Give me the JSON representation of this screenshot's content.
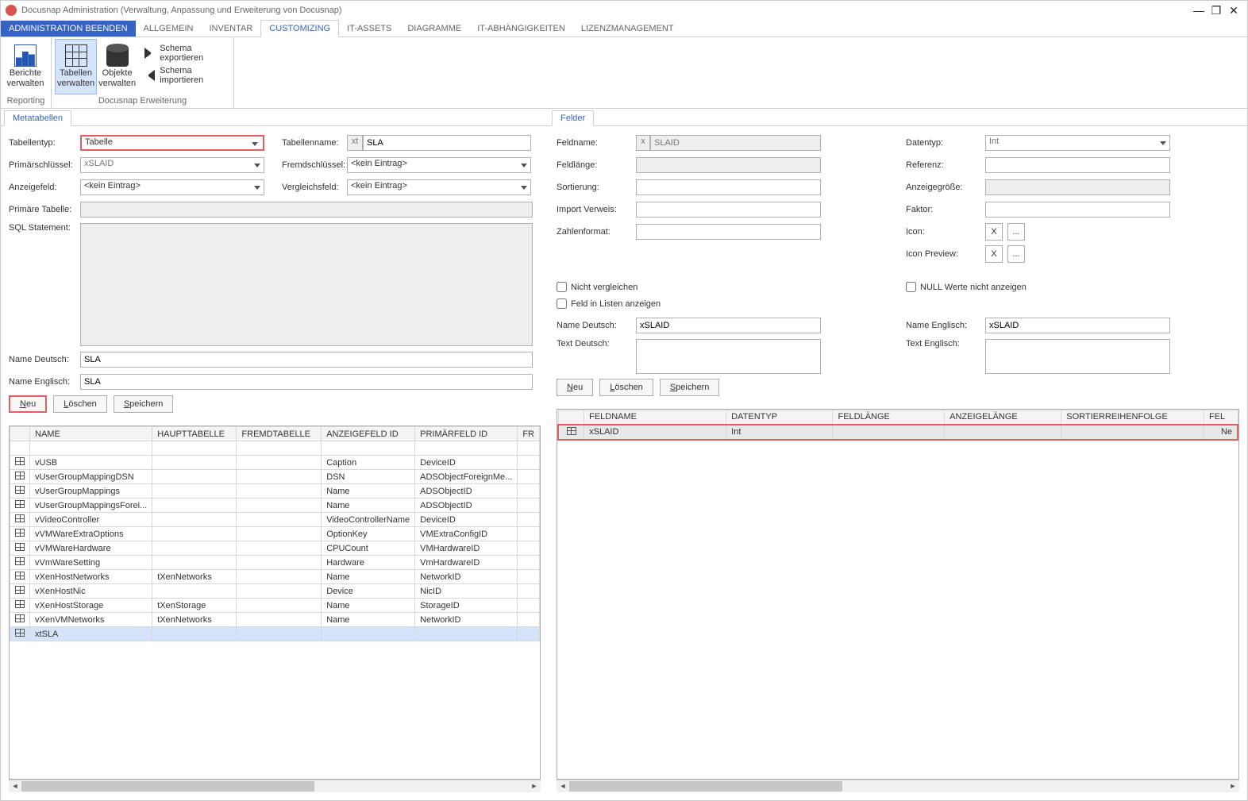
{
  "window": {
    "title": "Docusnap Administration (Verwaltung, Anpassung und Erweiterung von Docusnap)"
  },
  "winbuttons": {
    "min": "—",
    "max": "❐",
    "close": "✕"
  },
  "maintabs": {
    "file": "Administration beenden",
    "items": [
      "ALLGEMEIN",
      "INVENTAR",
      "CUSTOMIZING",
      "IT-ASSETS",
      "DIAGRAMME",
      "IT-ABHÄNGIGKEITEN",
      "LIZENZMANAGEMENT"
    ],
    "activeIndex": 2
  },
  "ribbon": {
    "group_reporting": {
      "label": "Reporting",
      "btn_reports": "Berichte verwalten"
    },
    "group_ext": {
      "label": "Docusnap Erweiterung",
      "btn_tables": "Tabellen verwalten",
      "btn_objects": "Objekte verwalten",
      "btn_export": "Schema exportieren",
      "btn_import": "Schema importieren"
    }
  },
  "left": {
    "tab": "Metatabellen",
    "labels": {
      "tabellentyp": "Tabellentyp:",
      "primaer": "Primärschlüssel:",
      "anzeigefeld": "Anzeigefeld:",
      "primTab": "Primäre Tabelle:",
      "sql": "SQL Statement:",
      "nameDE": "Name Deutsch:",
      "nameEN": "Name Englisch:",
      "tabellenname": "Tabellenname:",
      "fremd": "Fremdschlüssel:",
      "vergleich": "Vergleichsfeld:"
    },
    "values": {
      "tabellentyp": "Tabelle",
      "primaer": "xSLAID",
      "anzeigefeld": "<kein Eintrag>",
      "primTab": "",
      "sql": "",
      "nameDE": "SLA",
      "nameEN": "SLA",
      "tabellenname_prefix": "xt",
      "tabellenname": "SLA",
      "fremd": "<kein Eintrag>",
      "vergleich": "<kein Eintrag>"
    },
    "buttons": {
      "neu": "Neu",
      "loeschen": "Löschen",
      "speichern": "Speichern"
    },
    "grid": {
      "cols": [
        "",
        "NAME",
        "HAUPTTABELLE",
        "FREMDTABELLE",
        "ANZEIGEFELD ID",
        "PRIMÄRFELD ID",
        "FR"
      ],
      "rows": [
        {
          "n": "vUSB",
          "h": "",
          "f": "",
          "a": "Caption",
          "p": "DeviceID"
        },
        {
          "n": "vUserGroupMappingDSN",
          "h": "",
          "f": "",
          "a": "DSN",
          "p": "ADSObjectForeignMe..."
        },
        {
          "n": "vUserGroupMappings",
          "h": "",
          "f": "",
          "a": "Name",
          "p": "ADSObjectID"
        },
        {
          "n": "vUserGroupMappingsForei...",
          "h": "",
          "f": "",
          "a": "Name",
          "p": "ADSObjectID"
        },
        {
          "n": "vVideoController",
          "h": "",
          "f": "",
          "a": "VideoControllerName",
          "p": "DeviceID"
        },
        {
          "n": "vVMWareExtraOptions",
          "h": "",
          "f": "",
          "a": "OptionKey",
          "p": "VMExtraConfigID"
        },
        {
          "n": "vVMWareHardware",
          "h": "",
          "f": "",
          "a": "CPUCount",
          "p": "VMHardwareID"
        },
        {
          "n": "vVmWareSetting",
          "h": "",
          "f": "",
          "a": "Hardware",
          "p": "VmHardwareID"
        },
        {
          "n": "vXenHostNetworks",
          "h": "tXenNetworks",
          "f": "",
          "a": "Name",
          "p": "NetworkID"
        },
        {
          "n": "vXenHostNic",
          "h": "",
          "f": "",
          "a": "Device",
          "p": "NicID"
        },
        {
          "n": "vXenHostStorage",
          "h": "tXenStorage",
          "f": "",
          "a": "Name",
          "p": "StorageID"
        },
        {
          "n": "vXenVMNetworks",
          "h": "tXenNetworks",
          "f": "",
          "a": "Name",
          "p": "NetworkID"
        },
        {
          "n": "xtSLA",
          "h": "",
          "f": "",
          "a": "",
          "p": "",
          "sel": true
        }
      ]
    }
  },
  "right": {
    "tab": "Felder",
    "labels": {
      "feldname": "Feldname:",
      "feldlaenge": "Feldlänge:",
      "sortierung": "Sortierung:",
      "importverweis": "Import Verweis:",
      "zahlenformat": "Zahlenformat:",
      "datentyp": "Datentyp:",
      "referenz": "Referenz:",
      "anzeigegroesse": "Anzeigegröße:",
      "faktor": "Faktor:",
      "icon": "Icon:",
      "iconpreview": "Icon Preview:",
      "nichtvergleichen": "Nicht vergleichen",
      "feldinlisten": "Feld in Listen anzeigen",
      "nullwerte": "NULL Werte nicht anzeigen",
      "nameDE": "Name Deutsch:",
      "nameEN": "Name Englisch:",
      "textDE": "Text Deutsch:",
      "textEN": "Text Englisch:"
    },
    "values": {
      "feldname_prefix": "x",
      "feldname": "SLAID",
      "datentyp": "Int",
      "nameDE": "xSLAID",
      "nameEN": "xSLAID"
    },
    "iconbtn": {
      "clear": "X",
      "browse": "..."
    },
    "buttons": {
      "neu": "Neu",
      "loeschen": "Löschen",
      "speichern": "Speichern"
    },
    "grid": {
      "cols": [
        "",
        "FELDNAME",
        "DATENTYP",
        "FELDLÄNGE",
        "ANZEIGELÄNGE",
        "SORTIERREIHENFOLGE",
        "FEL"
      ],
      "rows": [
        {
          "feldname": "xSLAID",
          "datentyp": "Int",
          "fl": "",
          "al": "",
          "sort": "",
          "fel": "Ne"
        }
      ]
    }
  }
}
